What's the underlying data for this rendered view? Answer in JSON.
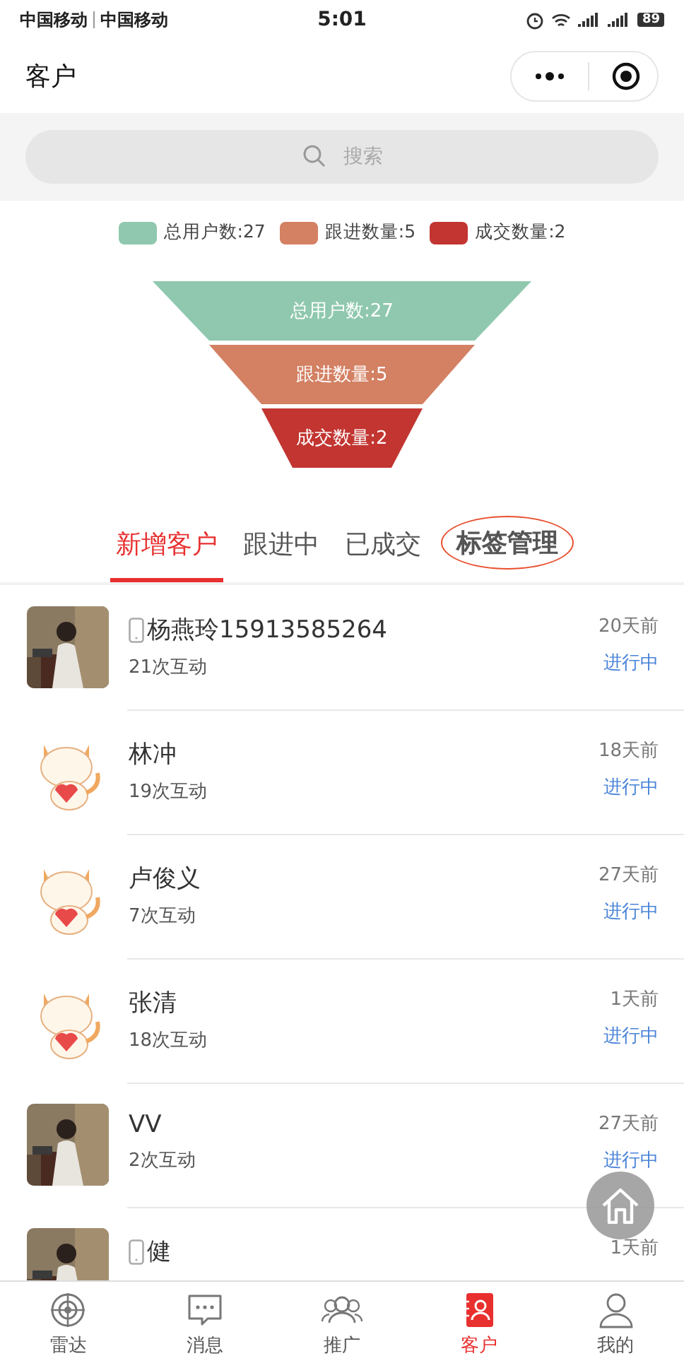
{
  "status_bar": {
    "carrier_1": "中国移动",
    "carrier_2": "中国移动",
    "time": "5:01",
    "battery": "89"
  },
  "nav": {
    "title": "客户"
  },
  "search": {
    "placeholder": "搜索"
  },
  "legend": [
    {
      "label": "总用户数:27",
      "color": "#8fc8ae"
    },
    {
      "label": "跟进数量:5",
      "color": "#d38063"
    },
    {
      "label": "成交数量:2",
      "color": "#c23531"
    }
  ],
  "funnel": [
    {
      "label": "总用户数:27",
      "color": "#8fc8ae"
    },
    {
      "label": "跟进数量:5",
      "color": "#d38063"
    },
    {
      "label": "成交数量:2",
      "color": "#c23531"
    }
  ],
  "tabs": [
    {
      "label": "新增客户",
      "selected": true,
      "circled": false
    },
    {
      "label": "跟进中",
      "selected": false,
      "circled": false
    },
    {
      "label": "已成交",
      "selected": false,
      "circled": false
    },
    {
      "label": "标签管理",
      "selected": false,
      "circled": true
    }
  ],
  "customers": [
    {
      "phone": true,
      "name": "杨燕玲15913585264",
      "interactions": "21次互动",
      "time": "20天前",
      "status": "进行中"
    },
    {
      "kind": "cat",
      "phone": false,
      "name": "林冲",
      "interactions": "19次互动",
      "time": "18天前",
      "status": "进行中"
    },
    {
      "kind": "cat",
      "phone": false,
      "name": "卢俊义",
      "interactions": "7次互动",
      "time": "27天前",
      "status": "进行中"
    },
    {
      "kind": "cat",
      "phone": false,
      "name": "张清",
      "interactions": "18次互动",
      "time": "1天前",
      "status": "进行中"
    },
    {
      "phone": false,
      "name": "VV",
      "interactions": "2次互动",
      "time": "27天前",
      "status": "进行中"
    },
    {
      "phone": true,
      "name": "健",
      "time": "1天前"
    }
  ],
  "tab_bar": [
    {
      "label": "雷达",
      "selected": false
    },
    {
      "label": "消息",
      "selected": false
    },
    {
      "label": "推广",
      "selected": false
    },
    {
      "label": "客户",
      "selected": true
    },
    {
      "label": "我的",
      "selected": false
    }
  ]
}
